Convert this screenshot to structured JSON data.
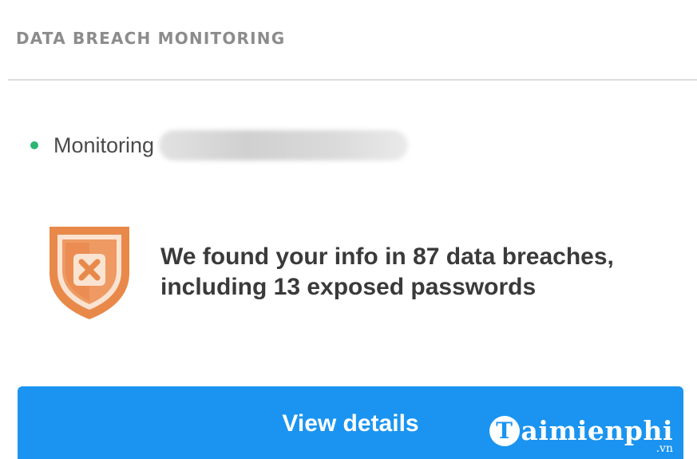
{
  "header": {
    "title": "DATA BREACH MONITORING"
  },
  "monitoring": {
    "status_label": "Monitoring",
    "status_color": "#2bb673",
    "redacted_value_icon": "redacted-blur"
  },
  "alert": {
    "icon": "shield-x-icon",
    "icon_color": "#e57c3b",
    "line1": "We found your info in 87 data breaches,",
    "line2": "including 13 exposed passwords"
  },
  "cta": {
    "label": "View details",
    "color": "#1a94f0"
  },
  "watermark": {
    "logo_letter": "T",
    "brand_text": "aimienphi",
    "suffix": ".vn"
  }
}
